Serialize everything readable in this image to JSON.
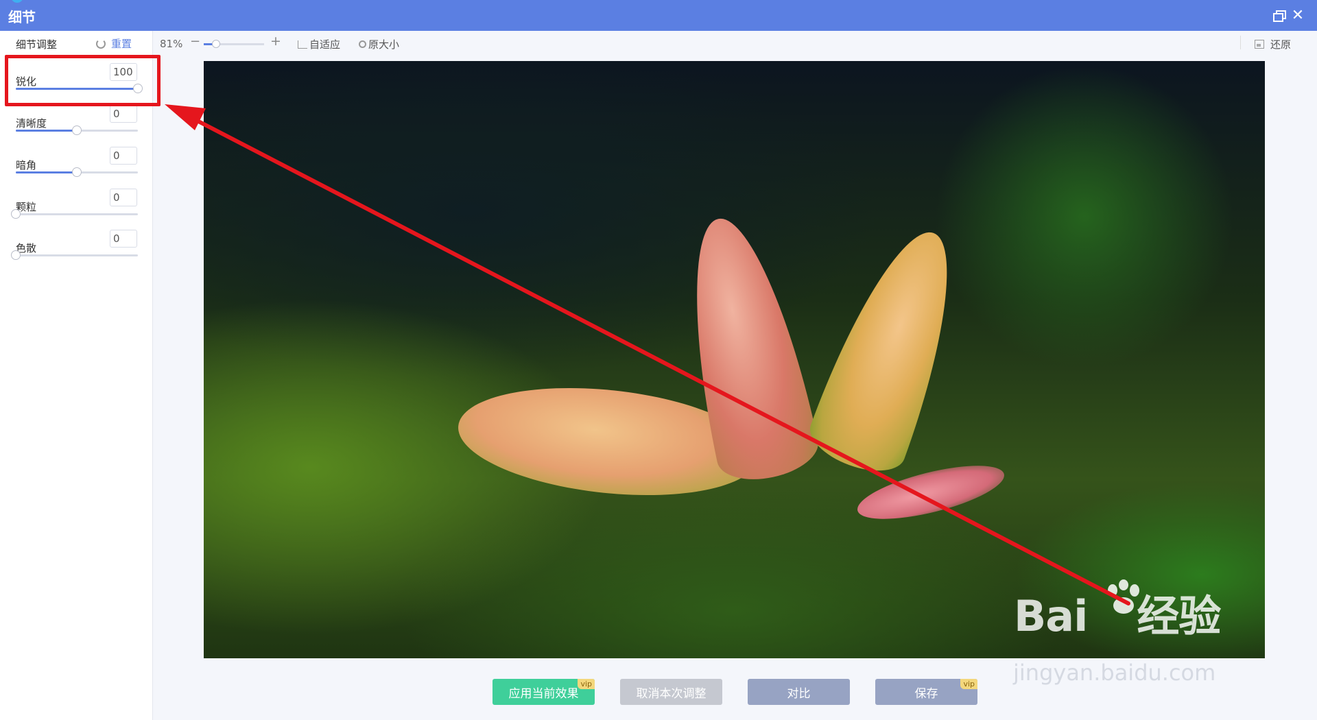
{
  "window": {
    "title": "细节"
  },
  "sidebar": {
    "title": "细节调整",
    "reset_label": "重置",
    "sliders": [
      {
        "label": "锐化",
        "value": "100",
        "fraction": 1.0
      },
      {
        "label": "清晰度",
        "value": "0",
        "fraction": 0.5
      },
      {
        "label": "暗角",
        "value": "0",
        "fraction": 0.5
      },
      {
        "label": "颗粒",
        "value": "0",
        "fraction": 0.0
      },
      {
        "label": "色散",
        "value": "0",
        "fraction": 0.0
      }
    ]
  },
  "toolbar": {
    "zoom_value": "81%",
    "zoom_minus": "−",
    "zoom_plus": "+",
    "zoom_fraction": 0.2,
    "fit_label": "自适应",
    "original_size_label": "原大小",
    "restore_label": "还原"
  },
  "watermark": {
    "brand": "Bai",
    "brand_cn": "经验",
    "url": "jingyan.baidu.com"
  },
  "actions": {
    "apply": "应用当前效果",
    "cancel": "取消本次调整",
    "compare": "对比",
    "save": "保存",
    "vip_badge": "vip"
  },
  "colors": {
    "titlebar": "#5b7fe2",
    "accent": "#5b7fe2",
    "apply_button": "#3fcf9a",
    "annotation": "#e5161d"
  }
}
